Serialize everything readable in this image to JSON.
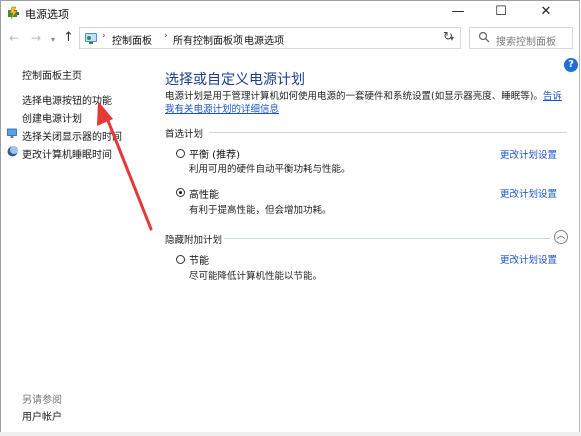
{
  "window": {
    "title": "电源选项",
    "minimize": "—",
    "maximize": "☐",
    "close": "✕"
  },
  "nav": {
    "back": "←",
    "forward": "→",
    "dropdown": "▾",
    "up": "↑",
    "refresh": "↻"
  },
  "address": {
    "crumbs": [
      "控制面板",
      "所有控制面板项",
      "电源选项"
    ],
    "separator": "›",
    "dropdown": "▾"
  },
  "search": {
    "placeholder": "搜索控制面板"
  },
  "sidebar": {
    "home": "控制面板主页",
    "items": [
      {
        "label": "选择电源按钮的功能"
      },
      {
        "label": "创建电源计划"
      },
      {
        "label": "选择关闭显示器的时间"
      },
      {
        "label": "更改计算机睡眠时间"
      }
    ],
    "see_also": "另请参阅",
    "user_accounts": "用户帐户"
  },
  "main": {
    "help": "?",
    "title": "选择或自定义电源计划",
    "description": "电源计划是用于管理计算机如何使用电源的一套硬件和系统设置(如显示器亮度、睡眠等)。",
    "description_link": "告诉我有关电源计划的详细信息",
    "preferred_label": "首选计划",
    "hidden_label": "隐藏附加计划",
    "collapse": "︿",
    "plans": [
      {
        "name": "平衡 (推荐)",
        "desc": "利用可用的硬件自动平衡功耗与性能。",
        "link": "更改计划设置",
        "selected": false
      },
      {
        "name": "高性能",
        "desc": "有利于提高性能，但会增加功耗。",
        "link": "更改计划设置",
        "selected": true
      },
      {
        "name": "节能",
        "desc": "尽可能降低计算机性能以节能。",
        "link": "更改计划设置",
        "selected": false
      }
    ]
  },
  "colors": {
    "accent": "#1a55c8",
    "title": "#1a3d8f",
    "annotation_arrow": "#e53935"
  }
}
